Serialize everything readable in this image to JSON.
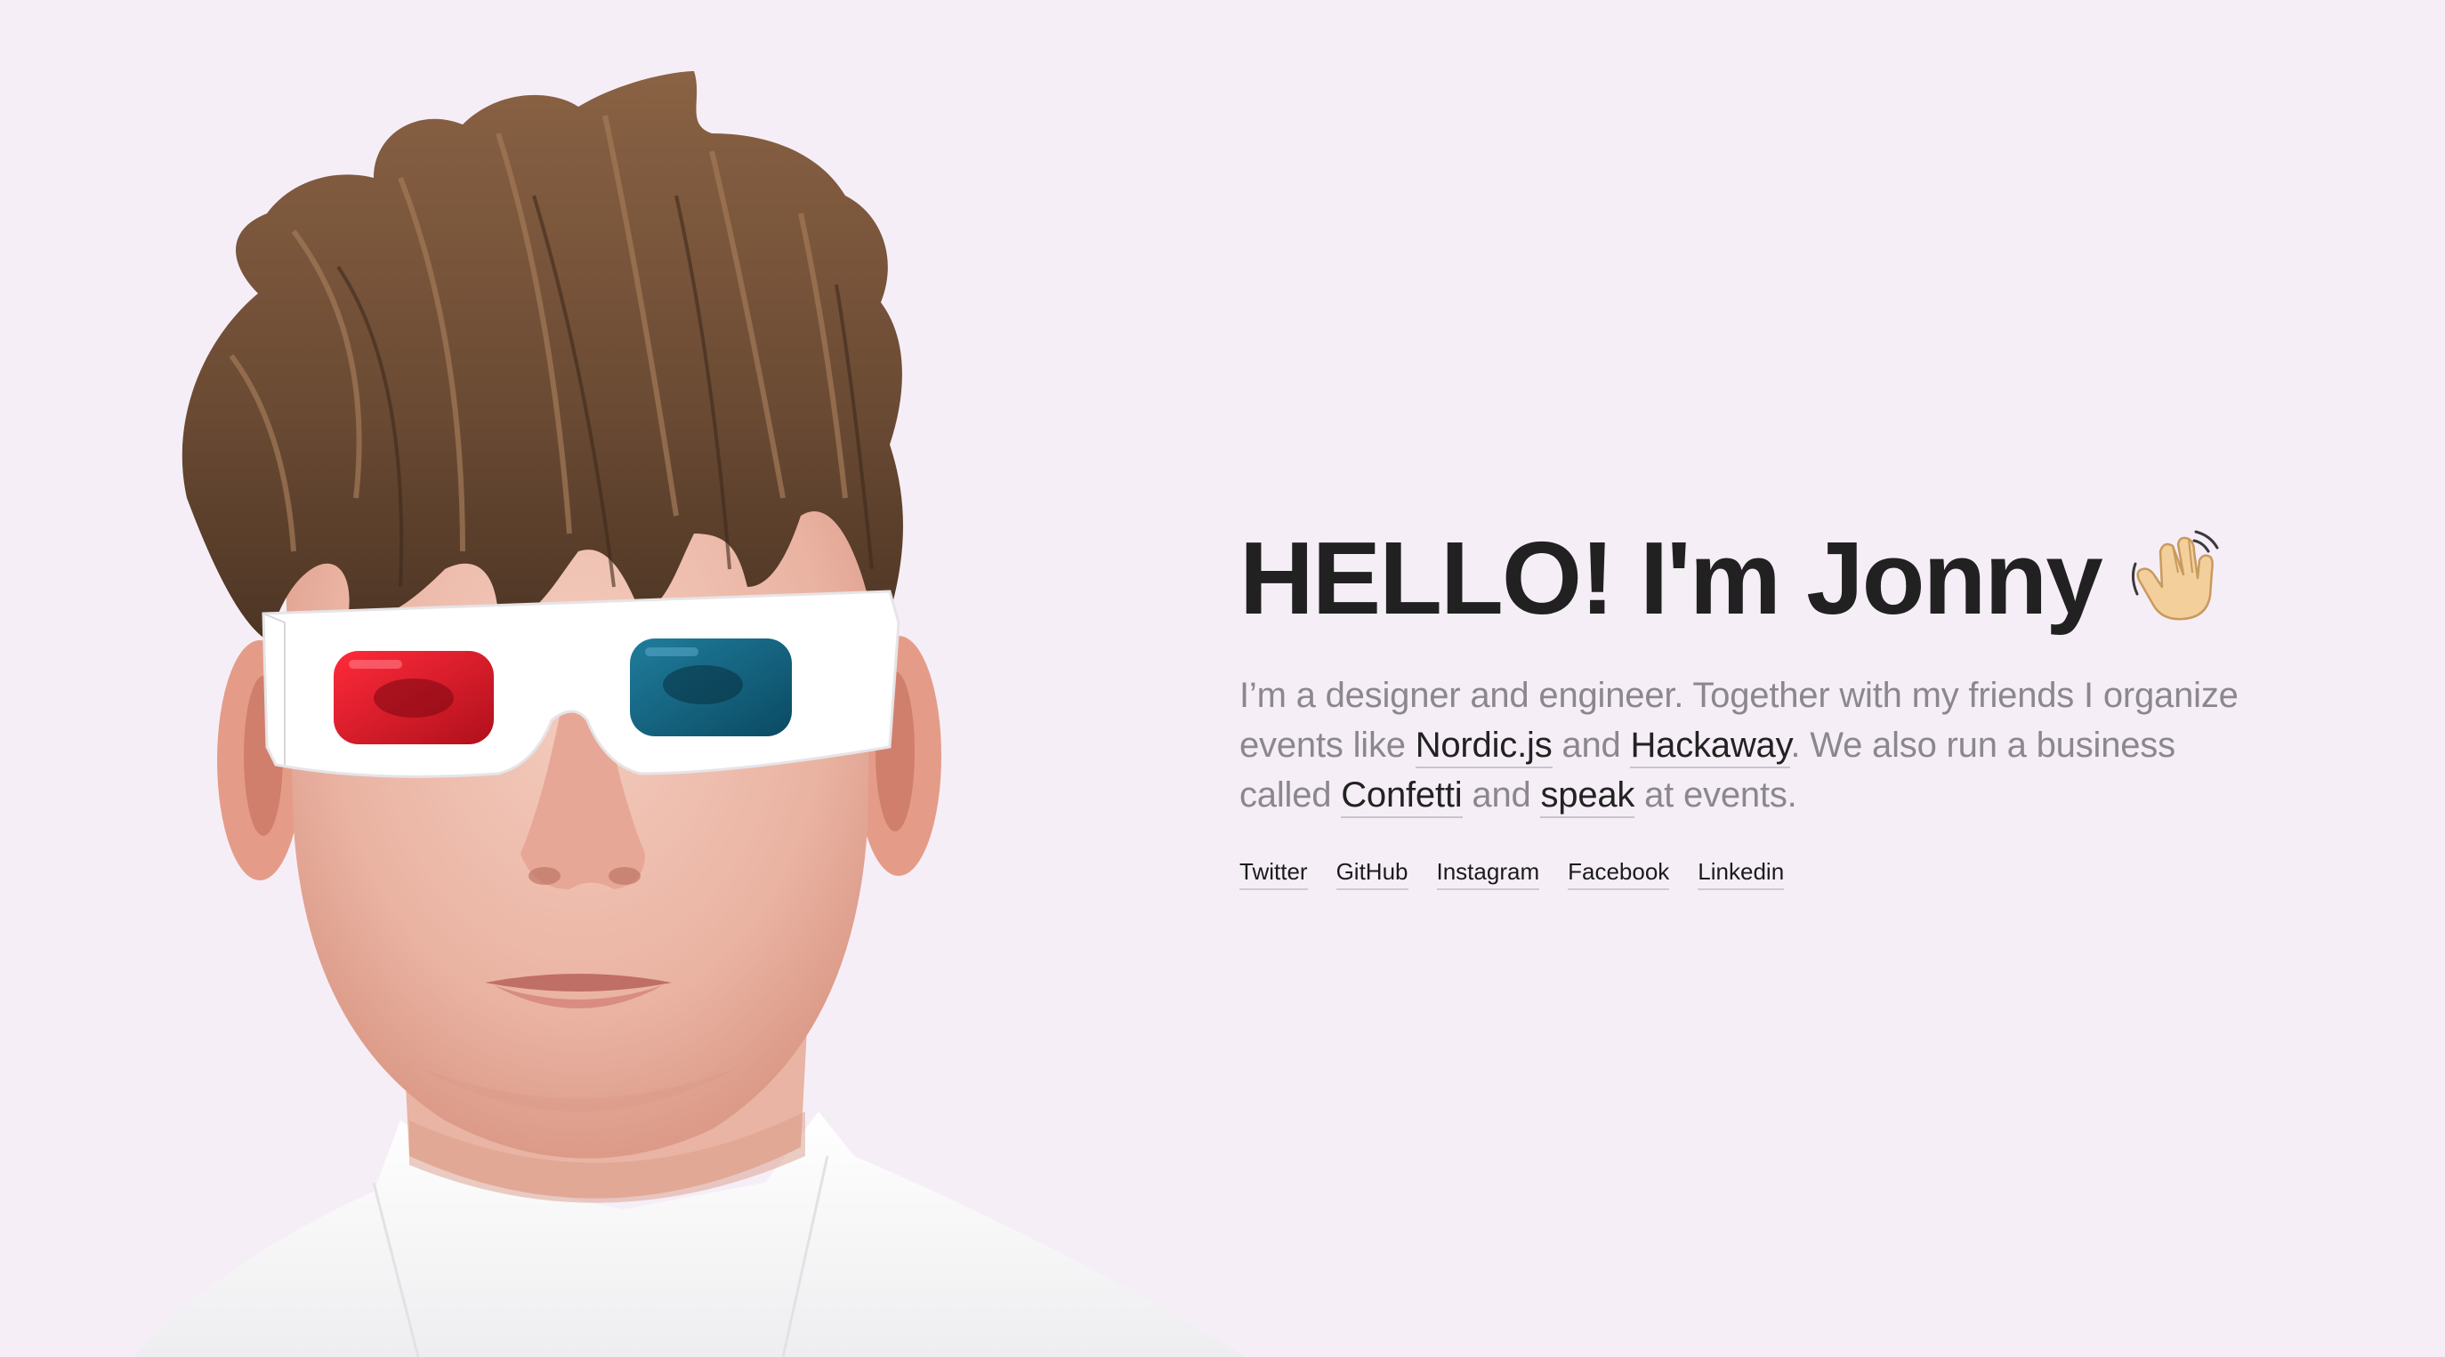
{
  "colors": {
    "background": "#f6eef7",
    "headline": "#212121",
    "body_text": "#8b878e",
    "link": "#222222"
  },
  "portrait": {
    "icon": "person-3d-glasses-illustration"
  },
  "intro": {
    "greeting": "HELLO! I'm Jonny",
    "greeting_icon": "waving-hand-icon",
    "bio": {
      "p1": "I’m a designer and engineer. Together with my friends I organize events like ",
      "link_nordic": "Nordic.js",
      "p2": " and ",
      "link_hackaway": "Hackaway",
      "p3": ". We also run a business called ",
      "link_confetti": "Confetti",
      "p4": " and ",
      "link_speak": "speak",
      "p5": " at events."
    },
    "social": [
      "Twitter",
      "GitHub",
      "Instagram",
      "Facebook",
      "Linkedin"
    ]
  }
}
